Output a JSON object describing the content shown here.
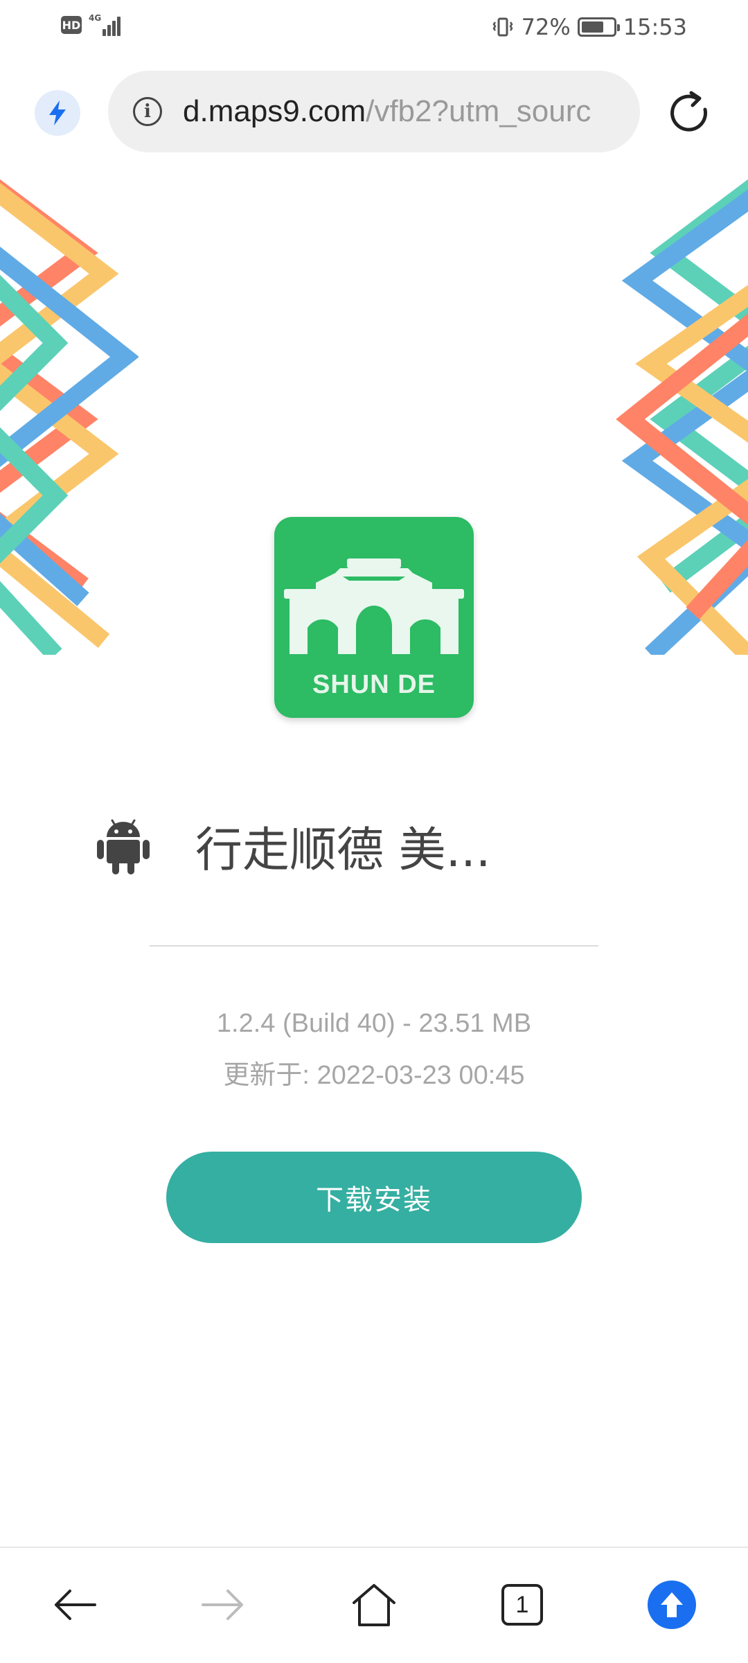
{
  "status_bar": {
    "hd_label": "HD",
    "network_label": "4G",
    "battery_percent": "72%",
    "battery_level": 0.72,
    "time": "15:53",
    "icons": [
      "hd-icon",
      "signal-icon",
      "vibrate-icon",
      "battery-icon"
    ]
  },
  "browser": {
    "url_host": "d.maps9.com",
    "url_path": "/vfb2?utm_sourc",
    "icons": [
      "bolt-icon",
      "info-icon",
      "reload-icon"
    ],
    "accent_color": "#1a6ff0"
  },
  "app": {
    "icon_label": "SHUN DE",
    "icon_color": "#2dbb64",
    "platform_icon": "android-icon",
    "title": "行走顺德  美...",
    "version_info": "1.2.4 (Build 40) - 23.51 MB",
    "updated_info": "更新于: 2022-03-23 00:45",
    "install_label": "下载安装",
    "install_color": "#35afa1"
  },
  "bottom_nav": {
    "items": [
      "back-icon",
      "forward-icon",
      "home-icon",
      "tabs-icon",
      "upload-icon"
    ],
    "tab_count": "1"
  }
}
